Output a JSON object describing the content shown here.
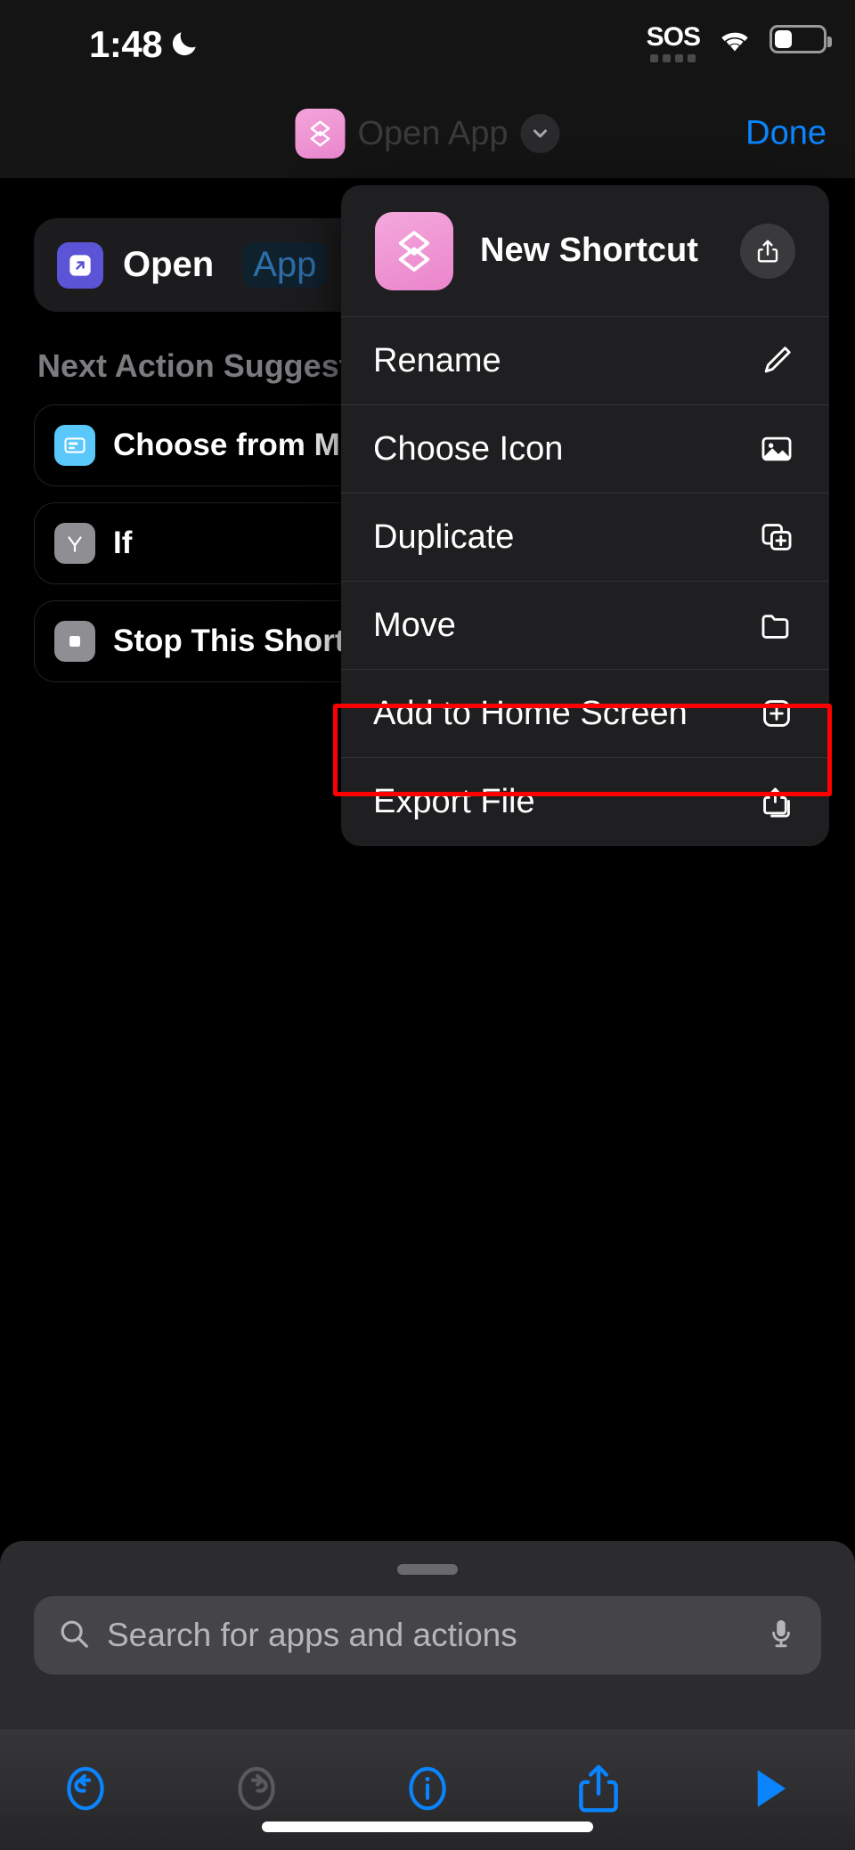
{
  "status_bar": {
    "time": "1:48",
    "moon_icon": "moon-icon",
    "sos_label": "SOS",
    "wifi_icon": "wifi-icon",
    "battery_icon": "battery-low-icon",
    "battery_level_percent": 32
  },
  "nav_bar": {
    "shortcut_icon": "shortcuts-layers-icon",
    "title": "Open App",
    "chevron_icon": "chevron-down-icon",
    "done_label": "Done"
  },
  "canvas": {
    "action": {
      "icon": "open-app-arrow-icon",
      "label": "Open",
      "token": "App"
    },
    "suggestions_header": "Next Action Suggestions",
    "suggestions": [
      {
        "icon": "menu-card-icon",
        "label": "Choose from Menu"
      },
      {
        "icon": "if-branch-icon",
        "label": "If"
      },
      {
        "icon": "stop-square-icon",
        "label": "Stop This Shortcut"
      }
    ]
  },
  "context_menu": {
    "app_icon": "shortcuts-layers-icon",
    "title": "New Shortcut",
    "share_button_icon": "share-icon",
    "items": [
      {
        "label": "Rename",
        "icon": "pencil-icon",
        "highlighted": false
      },
      {
        "label": "Choose Icon",
        "icon": "photo-icon",
        "highlighted": false
      },
      {
        "label": "Duplicate",
        "icon": "duplicate-plus-icon",
        "highlighted": false
      },
      {
        "label": "Move",
        "icon": "folder-icon",
        "highlighted": false
      },
      {
        "label": "Add to Home Screen",
        "icon": "plus-square-icon",
        "highlighted": true
      },
      {
        "label": "Export File",
        "icon": "export-share-icon",
        "highlighted": false
      }
    ],
    "highlight_color": "#ff0000"
  },
  "bottom_sheet": {
    "grabber": "drag-handle",
    "search": {
      "icon": "search-icon",
      "placeholder": "Search for apps and actions",
      "value": "",
      "mic_icon": "microphone-icon"
    }
  },
  "toolbar": {
    "buttons": [
      {
        "name": "undo-button",
        "icon": "undo-circle-icon",
        "enabled": true
      },
      {
        "name": "redo-button",
        "icon": "redo-circle-icon",
        "enabled": false
      },
      {
        "name": "info-button",
        "icon": "info-circle-icon",
        "enabled": true
      },
      {
        "name": "share-button",
        "icon": "share-icon",
        "enabled": true
      },
      {
        "name": "run-button",
        "icon": "play-icon",
        "enabled": true
      }
    ],
    "accent_color": "#0a84ff",
    "disabled_color": "#5a5a5c"
  },
  "home_indicator": "home-bar"
}
